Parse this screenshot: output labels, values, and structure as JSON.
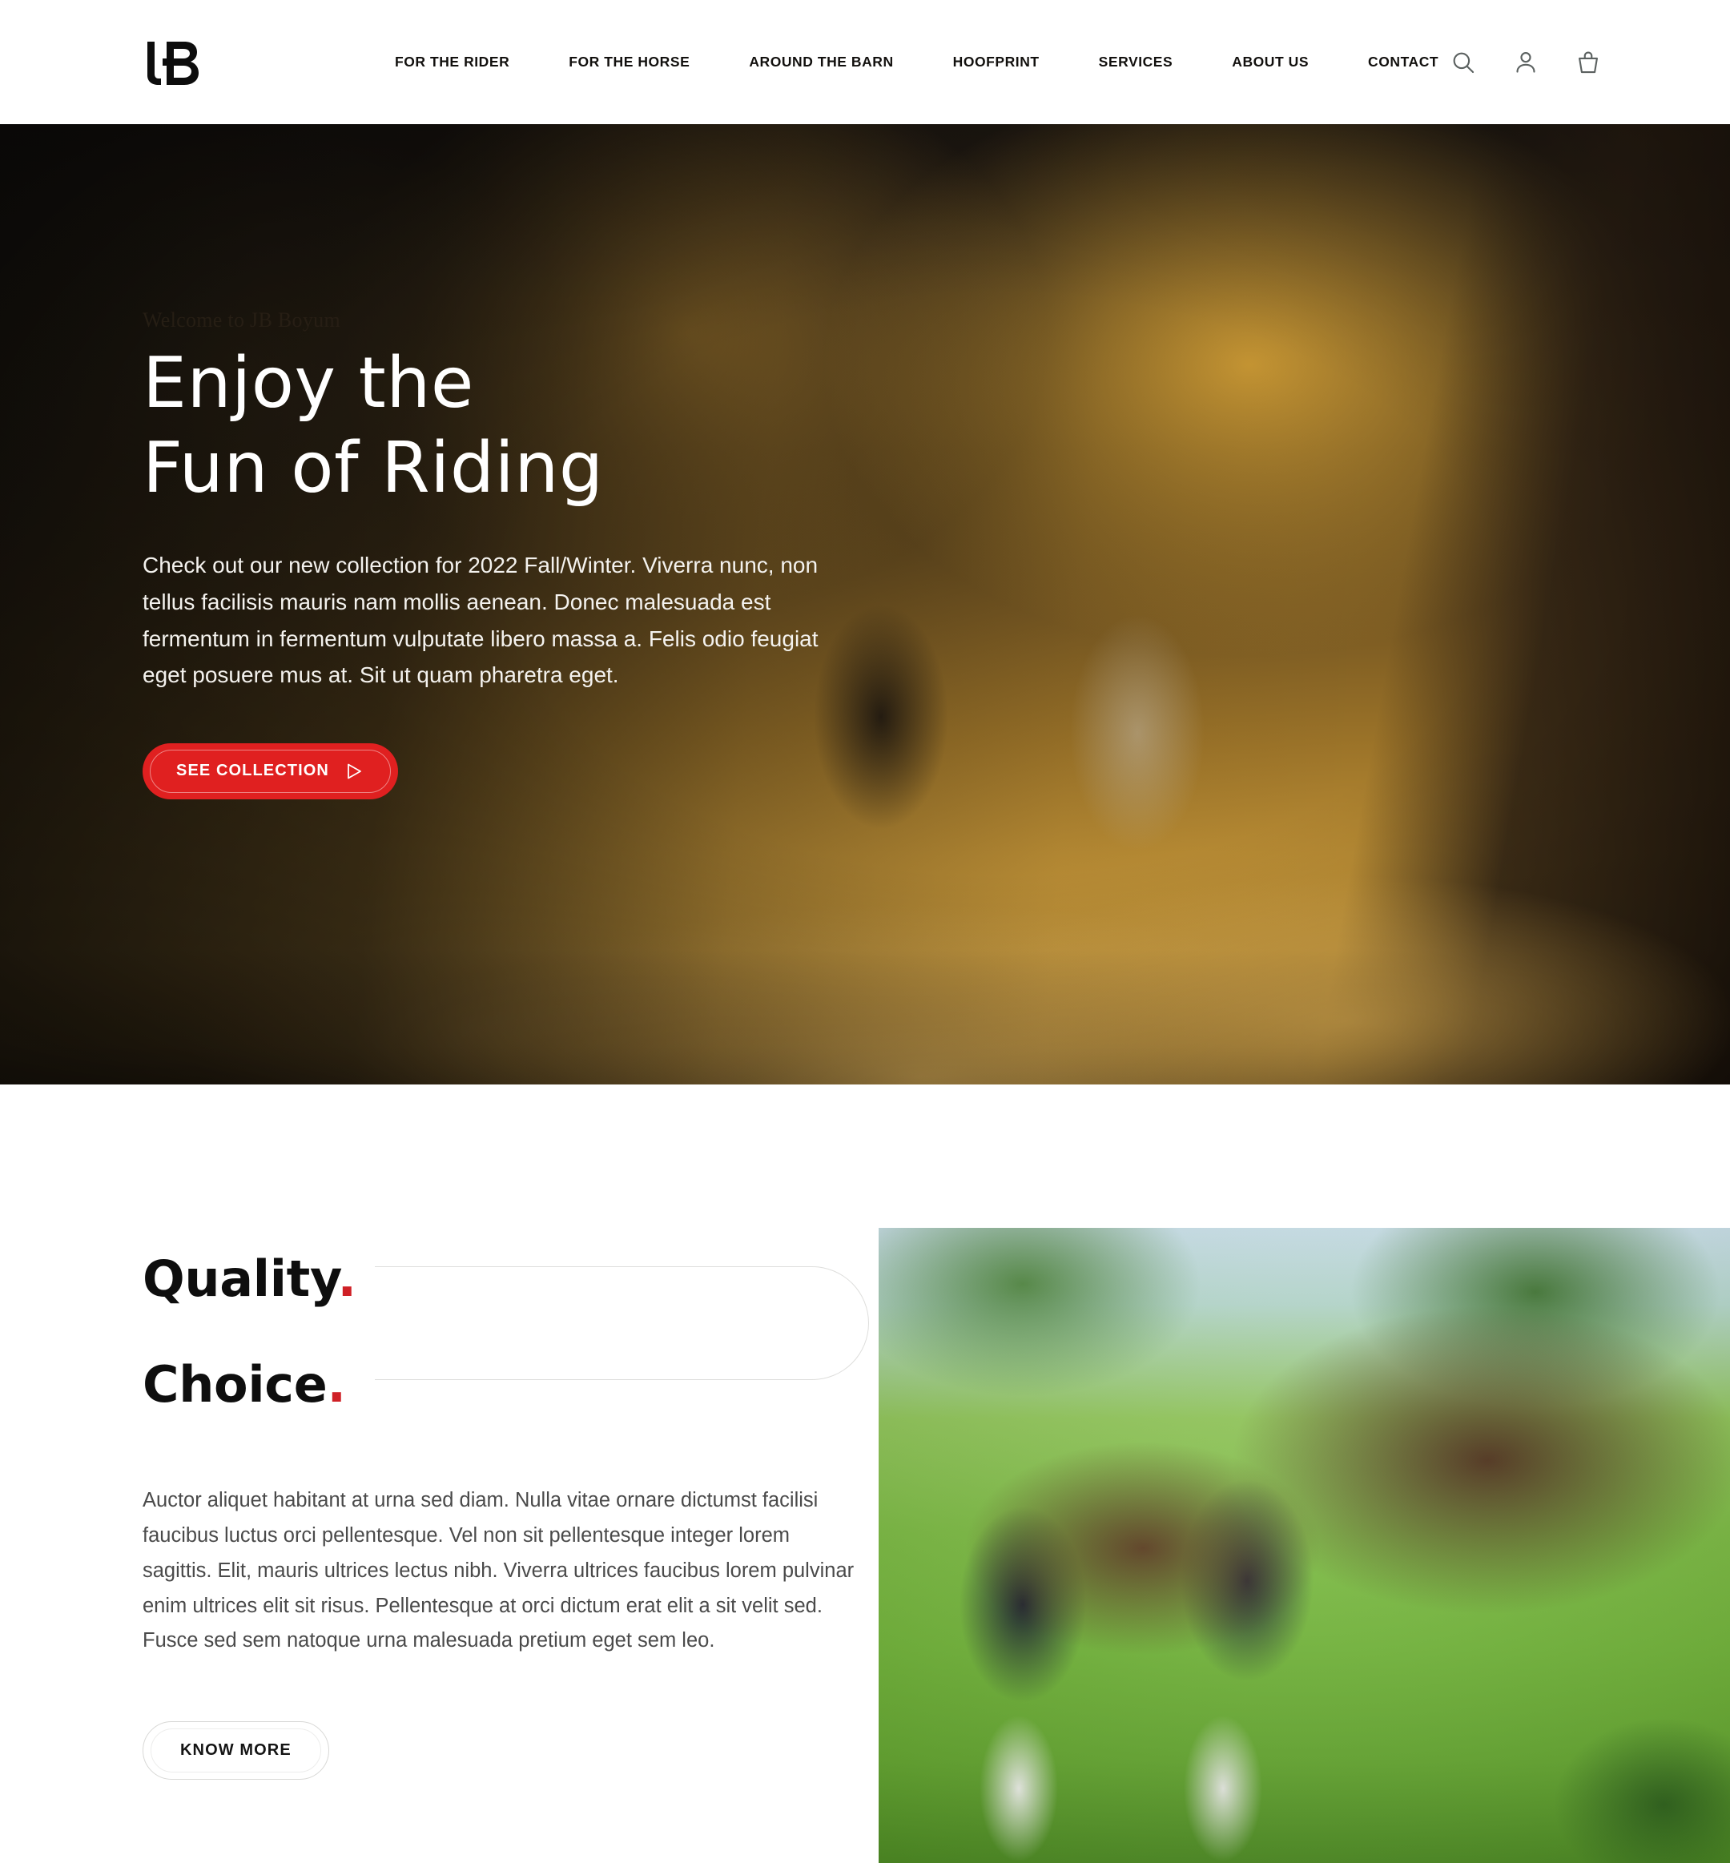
{
  "header": {
    "logo_text": "JB",
    "logo_name": "jb-logo",
    "nav": [
      {
        "label": "FOR THE RIDER"
      },
      {
        "label": "FOR THE HORSE"
      },
      {
        "label": "AROUND THE BARN"
      },
      {
        "label": "HOOFPRINT"
      },
      {
        "label": "SERVICES"
      },
      {
        "label": "ABOUT US"
      },
      {
        "label": "CONTACT"
      }
    ],
    "icons": [
      {
        "name": "search-icon"
      },
      {
        "name": "account-icon"
      },
      {
        "name": "cart-icon"
      }
    ]
  },
  "hero": {
    "eyebrow": "Welcome to JB Boyum",
    "title_line_1": "Enjoy the",
    "title_line_2": "Fun of Riding",
    "body": "Check out our new collection for 2022 Fall/Winter. Viverra nunc, non tellus facilisis mauris nam mollis aenean. Donec malesuada est fermentum in fermentum vulputate libero massa a. Felis odio feugiat eget posuere mus at. Sit ut quam pharetra eget.",
    "cta_label": "SEE COLLECTION",
    "cta_icon": "play-triangle-icon",
    "cta_color": "#e02020",
    "image_alt": "Two riders on horseback on an autumn woodland trail"
  },
  "feature": {
    "kicker_1": "Quality",
    "kicker_1_dot": ".",
    "kicker_2": "Choice",
    "kicker_2_dot": ".",
    "accent_color": "#cf2026",
    "body": "Auctor aliquet habitant at urna sed diam. Nulla vitae ornare dictumst facilisi faucibus luctus orci pellentesque. Vel non sit pellentesque integer lorem sagittis. Elit, mauris ultrices lectus nibh. Viverra ultrices faucibus lorem pulvinar enim ultrices elit sit risus. Pellentesque at orci dictum erat elit a sit velit sed. Fusce sed sem natoque urna malesuada pretium eget sem leo.",
    "cta_label": "KNOW MORE",
    "image_alt": "Two equestrians in show jackets standing beside a bay horse on grass"
  }
}
